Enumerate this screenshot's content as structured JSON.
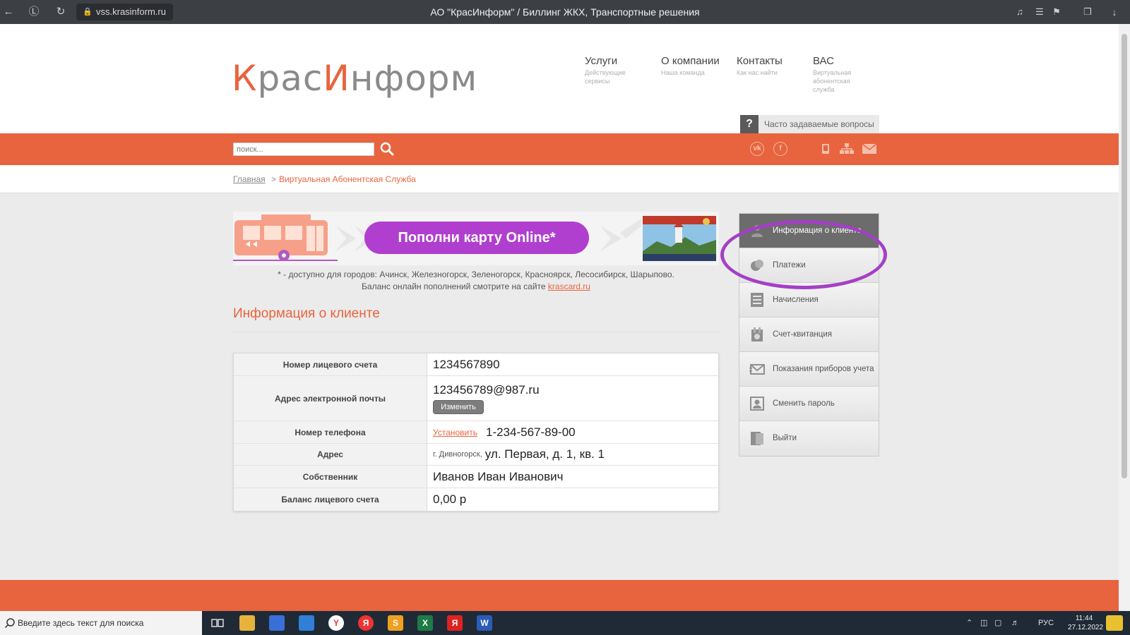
{
  "browser": {
    "url": "vss.krasinform.ru",
    "title": "АО \"КрасИнформ\" / Биллинг ЖКХ, Транспортные решения"
  },
  "logo": {
    "k": "К",
    "ras": "рас",
    "i": "И",
    "nform": "нформ"
  },
  "nav": [
    {
      "title": "Услуги",
      "sub": "Действующие сервисы"
    },
    {
      "title": "О компании",
      "sub": "Наша команда"
    },
    {
      "title": "Контакты",
      "sub": "Как нас найти"
    },
    {
      "title": "ВАС",
      "sub": "Виртуальная абонентская служба"
    }
  ],
  "faq": {
    "icon": "?",
    "label": "Часто задаваемые вопросы"
  },
  "search": {
    "placeholder": "поиск..."
  },
  "social": {
    "vk": "vk",
    "fb": "f"
  },
  "breadcrumb": {
    "home": "Главная",
    "separator": ">",
    "current": "Виртуальная Абонентская Служба"
  },
  "banner": {
    "button": "Пополни карту Online*",
    "note1": "* - доступно для городов: Ачинск, Железногорск, Зеленогорск, Красноярск, Лесосибирск, Шарыпово.",
    "note2_prefix": "Баланс онлайн пополнений смотрите на сайте ",
    "note2_link": "krascard.ru"
  },
  "section_title": "Информация о клиенте",
  "client": {
    "account_label": "Номер лицевого счета",
    "account_value": "1234567890",
    "email_label": "Адрес электронной почты",
    "email_value": "123456789@987.ru",
    "email_change": "Изменить",
    "phone_label": "Номер телефона",
    "phone_set": "Установить",
    "phone_value": "1-234-567-89-00",
    "address_label": "Адрес",
    "address_city": "г. Дивногорск,",
    "address_value": "ул. Первая, д. 1, кв. 1",
    "owner_label": "Собственник",
    "owner_value": "Иванов Иван Иванович",
    "balance_label": "Баланс лицевого счета",
    "balance_value": "0,00 р"
  },
  "sidebar": {
    "items": [
      {
        "label": "Информация о клиенте",
        "icon": "person-icon"
      },
      {
        "label": "Платежи",
        "icon": "coins-icon"
      },
      {
        "label": "Начисления",
        "icon": "list-icon"
      },
      {
        "label": "Счет-квитанция",
        "icon": "receipt-icon"
      },
      {
        "label": "Показания приборов учета",
        "icon": "envelope-icon"
      },
      {
        "label": "Сменить пароль",
        "icon": "id-card-icon"
      },
      {
        "label": "Выйти",
        "icon": "exit-icon"
      }
    ]
  },
  "taskbar": {
    "search_text": "Введите здесь текст для поиска",
    "lang": "РУС",
    "time": "11:44",
    "date": "27.12.2022"
  },
  "colors": {
    "accent": "#e8643e",
    "highlight": "#a43fc6",
    "banner_button": "#b03fcf"
  }
}
